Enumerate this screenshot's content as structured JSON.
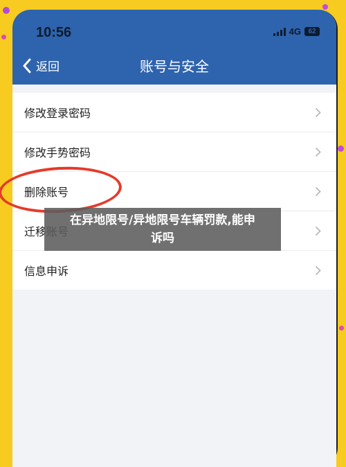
{
  "status_bar": {
    "time": "10:56",
    "network": "4G",
    "battery": "62"
  },
  "nav": {
    "back_label": "返回",
    "title": "账号与安全"
  },
  "menu": {
    "items": [
      {
        "label": "修改登录密码"
      },
      {
        "label": "修改手势密码"
      },
      {
        "label": "删除账号"
      },
      {
        "label": "迁移账号"
      },
      {
        "label": "信息申诉"
      }
    ]
  },
  "overlay_caption": {
    "line1": "在异地限号/异地限号车辆罚款,能申",
    "line2": "诉吗"
  },
  "colors": {
    "header": "#2e63ad",
    "background": "#f7cb1f",
    "annotation": "#e53a2a"
  },
  "icons": {
    "back": "chevron-left-icon",
    "row_arrow": "chevron-right-icon"
  }
}
